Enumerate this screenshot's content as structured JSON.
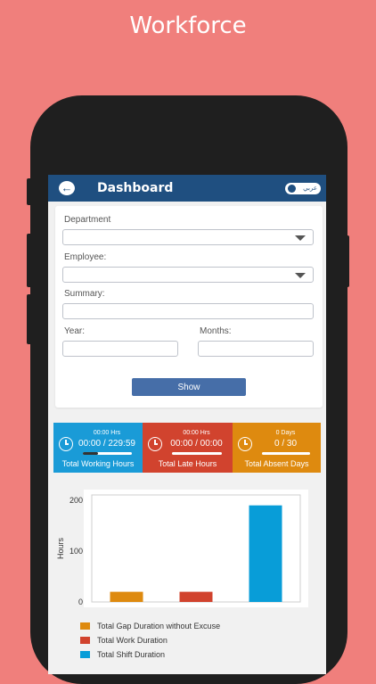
{
  "promo": {
    "title": "Workforce"
  },
  "appbar": {
    "title": "Dashboard",
    "back_icon": "back-arrow-icon",
    "lang_label": "عربي"
  },
  "filters": {
    "department_label": "Department",
    "department_value": "",
    "employee_label": "Employee:",
    "employee_value": "",
    "summary_label": "Summary:",
    "summary_value": "",
    "year_label": "Year:",
    "year_value": "",
    "months_label": "Months:",
    "months_value": "",
    "show_label": "Show"
  },
  "stats": [
    {
      "small": "00:00 Hrs",
      "value": "00:00 / 229:59",
      "name": "Total Working Hours",
      "color": "#1a9bd7",
      "progress": 0.3,
      "icon": "clock-icon"
    },
    {
      "small": "00:00 Hrs",
      "value": "00:00 / 00:00",
      "name": "Total Late Hours",
      "color": "#d1432e",
      "progress": 0,
      "icon": "clock-icon"
    },
    {
      "small": "0 Days",
      "value": "0 / 30",
      "name": "Total Absent Days",
      "color": "#de8a0f",
      "progress": 0,
      "icon": "clock-icon"
    }
  ],
  "chart_data": {
    "type": "bar",
    "categories": [
      "Total Gap Duration without Excuse",
      "Total Work Duration",
      "Total Shift Duration"
    ],
    "values": [
      20,
      20,
      190
    ],
    "colors": [
      "#de8a0f",
      "#d1432e",
      "#089dd8"
    ],
    "ylabel": "Hours",
    "yticks": [
      0,
      100,
      200
    ],
    "ylim": [
      0,
      200
    ],
    "grid": false,
    "legend": "bottom",
    "legend_entries": [
      "Total Gap Duration without Excuse",
      "Total Work Duration",
      "Total Shift Duration"
    ]
  }
}
